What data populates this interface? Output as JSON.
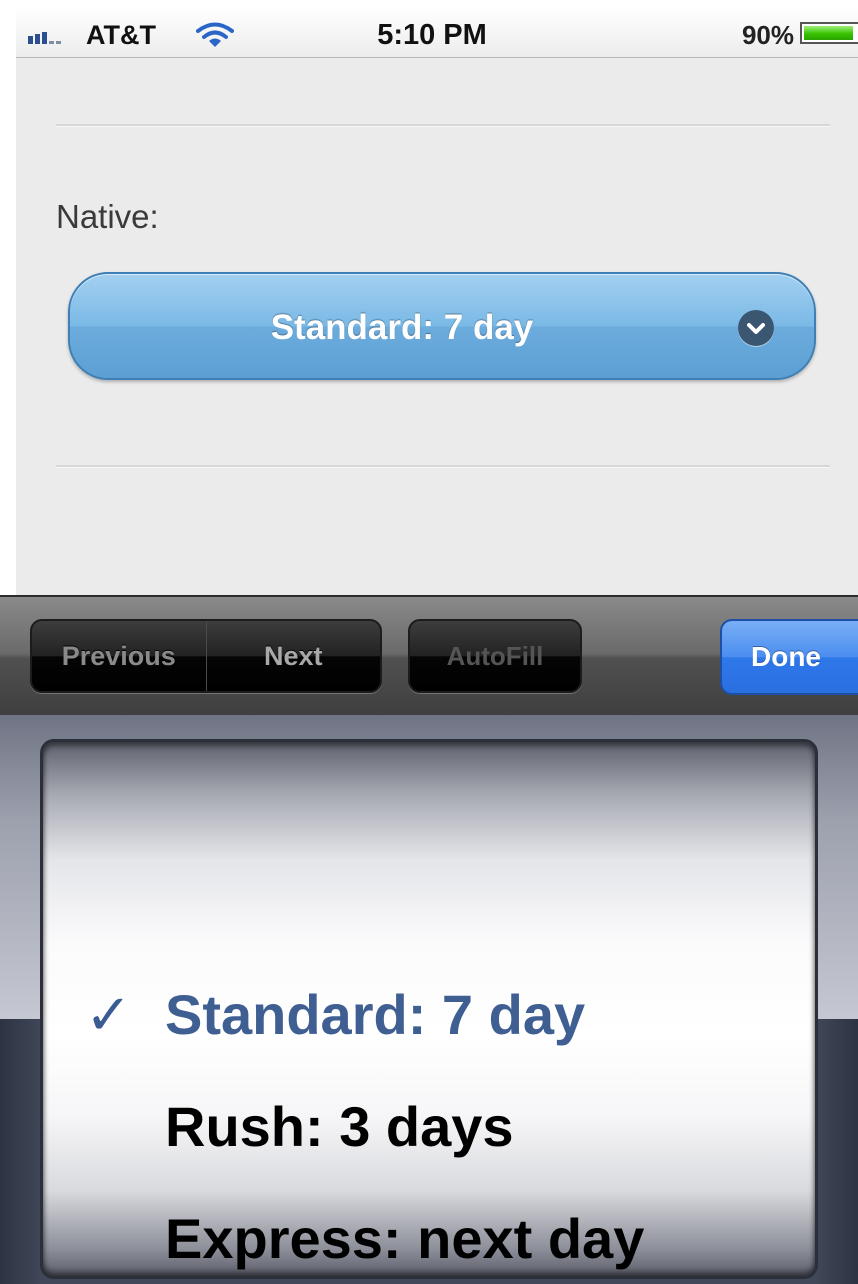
{
  "status_bar": {
    "carrier": "AT&T",
    "time": "5:10 PM",
    "battery_percent": "90%",
    "battery_level": 0.9,
    "signal_bars": 3,
    "icons": [
      "signal-icon",
      "wifi-icon",
      "battery-icon"
    ]
  },
  "form": {
    "label": "Native:",
    "select": {
      "selected_value": "Standard: 7 day",
      "icon": "chevron-down-icon",
      "color": "#7ab9e6"
    }
  },
  "toolbar": {
    "previous_label": "Previous",
    "next_label": "Next",
    "autofill_label": "AutoFill",
    "done_label": "Done",
    "done_color": "#2f78ea"
  },
  "picker": {
    "check_mark": "✓",
    "options": [
      {
        "label": "Standard: 7 day",
        "selected": true
      },
      {
        "label": "Rush: 3 days",
        "selected": false
      },
      {
        "label": "Express: next day",
        "selected": false
      }
    ],
    "selected_color": "#3f5f93"
  }
}
